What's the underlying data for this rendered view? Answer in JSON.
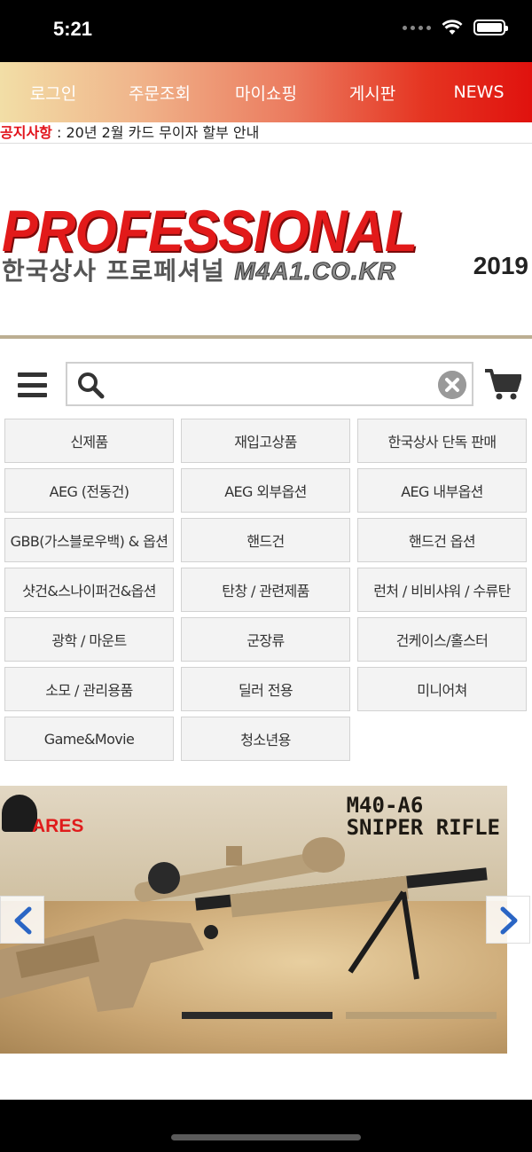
{
  "status": {
    "time": "5:21"
  },
  "nav": {
    "items": [
      {
        "label": "로그인"
      },
      {
        "label": "주문조회"
      },
      {
        "label": "마이쇼핑"
      },
      {
        "label": "게시판"
      },
      {
        "label": "NEWS"
      }
    ]
  },
  "notice": {
    "label": "공지사항",
    "separator": " : ",
    "text": "20년 2월 카드 무이자 할부 안내"
  },
  "logo": {
    "main": "PROFESSIONAL",
    "sub": "한국상사 프로페셔널",
    "domain": "M4A1.CO.KR",
    "year": "2019"
  },
  "search": {
    "value": "",
    "placeholder": ""
  },
  "categories": [
    {
      "label": "신제품"
    },
    {
      "label": "재입고상품"
    },
    {
      "label": "한국상사 단독 판매"
    },
    {
      "label": "AEG (전동건)"
    },
    {
      "label": "AEG 외부옵션"
    },
    {
      "label": "AEG 내부옵션"
    },
    {
      "label": "GBB(가스블로우백) & 옵션"
    },
    {
      "label": "핸드건"
    },
    {
      "label": "핸드건 옵션"
    },
    {
      "label": "샷건&스나이퍼건&옵션"
    },
    {
      "label": "탄창 / 관련제품"
    },
    {
      "label": "런처 / 비비샤워 / 수류탄"
    },
    {
      "label": "광학 / 마운트"
    },
    {
      "label": "군장류"
    },
    {
      "label": "건케이스/홀스터"
    },
    {
      "label": "소모 / 관리용품"
    },
    {
      "label": "딜러 전용"
    },
    {
      "label": "미니어쳐"
    },
    {
      "label": "Game&Movie"
    },
    {
      "label": "청소년용"
    }
  ],
  "banner": {
    "brand": "ARES",
    "title_line1": "M40-A6",
    "title_line2": "SNIPER RIFLE"
  },
  "colors": {
    "accent_red": "#e2131b",
    "nav_gradient_start": "#f2dea6",
    "nav_gradient_end": "#e0120e",
    "divider": "#bcae92"
  }
}
